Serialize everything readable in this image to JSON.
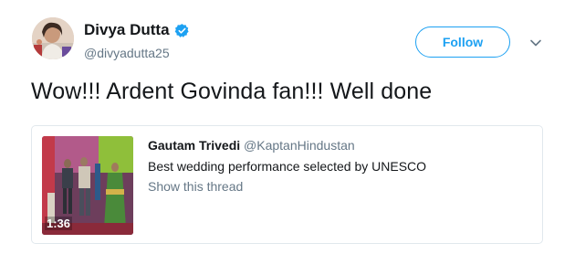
{
  "author": {
    "display_name": "Divya Dutta",
    "handle": "@divyadutta25",
    "verified": true,
    "avatar_icon": "user-avatar"
  },
  "actions": {
    "follow_label": "Follow",
    "more_icon": "chevron-down-icon"
  },
  "tweet": {
    "text": "Wow!!! Ardent Govinda fan!!! Well done"
  },
  "quoted_tweet": {
    "author_name": "Gautam Trivedi",
    "author_handle": "@KaptanHindustan",
    "text": "Best wedding performance selected by UNESCO",
    "show_thread_label": "Show this thread",
    "video_duration": "1:36"
  },
  "colors": {
    "brand_blue": "#1da1f2",
    "text_primary": "#14171a",
    "text_secondary": "#657786",
    "border": "#e1e8ed"
  }
}
